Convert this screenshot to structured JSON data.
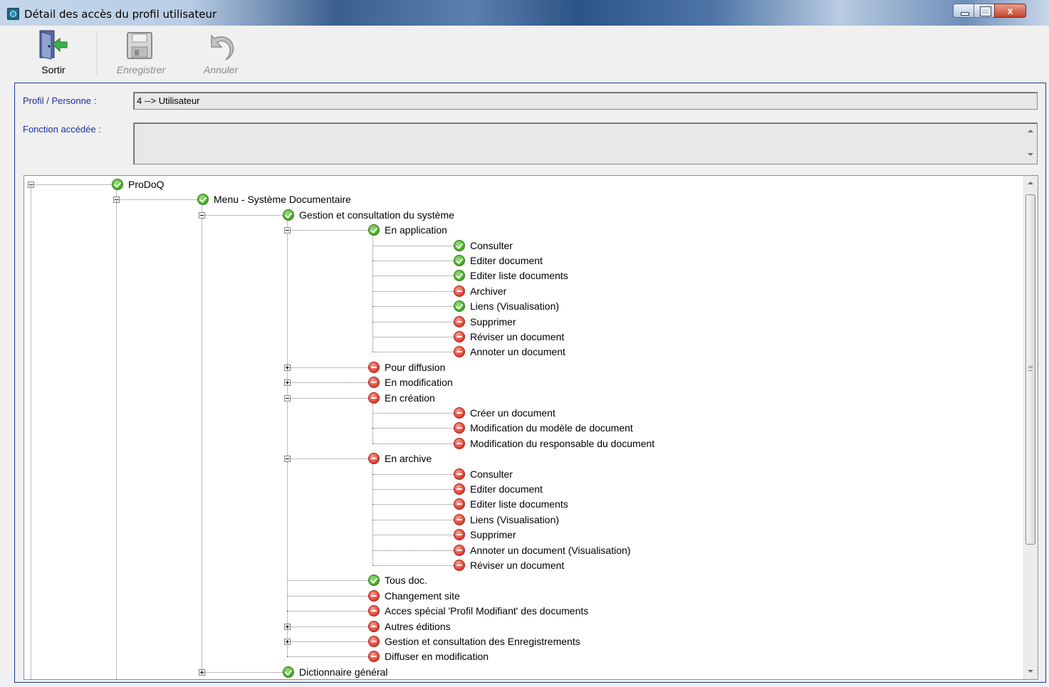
{
  "window": {
    "title": "Détail des accès du profil utilisateur",
    "close_symbol": "x"
  },
  "toolbar": {
    "buttons": [
      {
        "label": "Sortir",
        "icon": "exit-door-icon",
        "enabled": true
      },
      {
        "label": "Enregistrer",
        "icon": "floppy-disk-icon",
        "enabled": false
      },
      {
        "label": "Annuler",
        "icon": "undo-arrow-icon",
        "enabled": false
      }
    ]
  },
  "form": {
    "profil_label": "Profil / Personne :",
    "profil_value": "4 --> Utilisateur",
    "fonction_label": "Fonction accédée :",
    "fonction_value": ""
  },
  "colors": {
    "granted": "#4fae2e",
    "denied": "#e2473a",
    "label_blue": "#1c2fa0"
  },
  "tree": [
    {
      "label": "ProDoQ",
      "level": 0,
      "status": "granted",
      "expander": "minus"
    },
    {
      "label": "Menu - Système Documentaire",
      "level": 1,
      "status": "granted",
      "expander": "minus"
    },
    {
      "label": "Gestion et consultation du système",
      "level": 2,
      "status": "granted",
      "expander": "minus"
    },
    {
      "label": "En application",
      "level": 3,
      "status": "granted",
      "expander": "minus"
    },
    {
      "label": "Consulter",
      "level": 4,
      "status": "granted",
      "expander": "none"
    },
    {
      "label": "Editer document",
      "level": 4,
      "status": "granted",
      "expander": "none"
    },
    {
      "label": "Editer liste documents",
      "level": 4,
      "status": "granted",
      "expander": "none"
    },
    {
      "label": "Archiver",
      "level": 4,
      "status": "denied",
      "expander": "none"
    },
    {
      "label": "Liens (Visualisation)",
      "level": 4,
      "status": "granted",
      "expander": "none"
    },
    {
      "label": "Supprimer",
      "level": 4,
      "status": "denied",
      "expander": "none"
    },
    {
      "label": "Réviser un document",
      "level": 4,
      "status": "denied",
      "expander": "none"
    },
    {
      "label": "Annoter un document",
      "level": 4,
      "status": "denied",
      "expander": "none"
    },
    {
      "label": "Pour diffusion",
      "level": 3,
      "status": "denied",
      "expander": "plus"
    },
    {
      "label": "En modification",
      "level": 3,
      "status": "denied",
      "expander": "plus"
    },
    {
      "label": "En création",
      "level": 3,
      "status": "denied",
      "expander": "minus"
    },
    {
      "label": "Créer un document",
      "level": 4,
      "status": "denied",
      "expander": "none"
    },
    {
      "label": "Modification du modèle de document",
      "level": 4,
      "status": "denied",
      "expander": "none"
    },
    {
      "label": "Modification du responsable du document",
      "level": 4,
      "status": "denied",
      "expander": "none"
    },
    {
      "label": "En archive",
      "level": 3,
      "status": "denied",
      "expander": "minus"
    },
    {
      "label": "Consulter",
      "level": 4,
      "status": "denied",
      "expander": "none"
    },
    {
      "label": "Editer document",
      "level": 4,
      "status": "denied",
      "expander": "none"
    },
    {
      "label": "Editer liste documents",
      "level": 4,
      "status": "denied",
      "expander": "none"
    },
    {
      "label": "Liens (Visualisation)",
      "level": 4,
      "status": "denied",
      "expander": "none"
    },
    {
      "label": "Supprimer",
      "level": 4,
      "status": "denied",
      "expander": "none"
    },
    {
      "label": "Annoter un document (Visualisation)",
      "level": 4,
      "status": "denied",
      "expander": "none"
    },
    {
      "label": "Réviser un document",
      "level": 4,
      "status": "denied",
      "expander": "none"
    },
    {
      "label": "Tous doc.",
      "level": 3,
      "status": "granted",
      "expander": "none"
    },
    {
      "label": "Changement site",
      "level": 3,
      "status": "denied",
      "expander": "none"
    },
    {
      "label": "Acces spécial 'Profil Modifiant' des documents",
      "level": 3,
      "status": "denied",
      "expander": "none"
    },
    {
      "label": "Autres éditions",
      "level": 3,
      "status": "denied",
      "expander": "plus"
    },
    {
      "label": "Gestion et consultation des Enregistrements",
      "level": 3,
      "status": "denied",
      "expander": "plus"
    },
    {
      "label": "Diffuser en modification",
      "level": 3,
      "status": "denied",
      "expander": "none"
    },
    {
      "label": "Dictionnaire général",
      "level": 2,
      "status": "granted",
      "expander": "plus"
    }
  ]
}
